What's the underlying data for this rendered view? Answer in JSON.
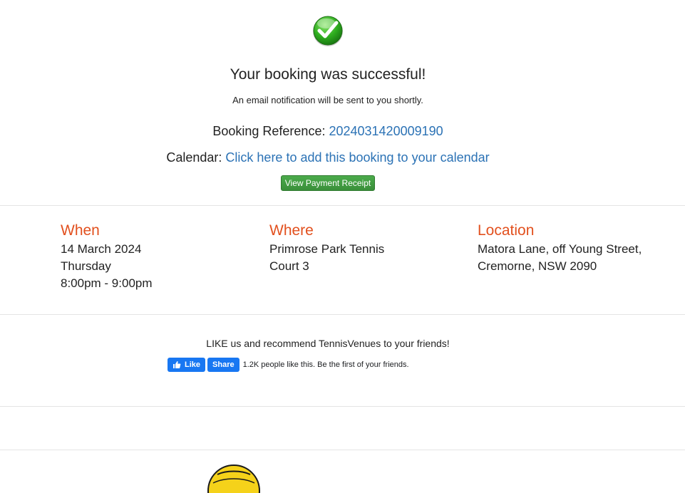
{
  "icons": {
    "success": "check-circle-icon",
    "like": "thumbs-up-icon",
    "logo": "tennis-ball-logo-icon"
  },
  "colors": {
    "accent_orange": "#e2501e",
    "link_blue": "#2b72b5",
    "button_green": "#3a8f3a",
    "facebook_blue": "#1877f2"
  },
  "confirmation": {
    "title": "Your booking was successful!",
    "subtitle": "An email notification will be sent to you shortly.",
    "reference_label": "Booking Reference: ",
    "reference_value": "2024031420009190",
    "calendar_label": "Calendar: ",
    "calendar_link": "Click here to add this booking to your calendar",
    "receipt_button": "View Payment Receipt"
  },
  "details": {
    "when": {
      "heading": "When",
      "lines": [
        "14 March 2024",
        "Thursday",
        "8:00pm - 9:00pm"
      ]
    },
    "where": {
      "heading": "Where",
      "lines": [
        "Primrose Park Tennis",
        "Court 3"
      ]
    },
    "location": {
      "heading": "Location",
      "lines": [
        "Matora Lane, off Young Street,",
        "Cremorne, NSW 2090"
      ]
    }
  },
  "social": {
    "prompt": "LIKE us and recommend TennisVenues to your friends!",
    "like_label": "Like",
    "share_label": "Share",
    "like_count_text": "1.2K people like this. Be the first of your friends."
  }
}
